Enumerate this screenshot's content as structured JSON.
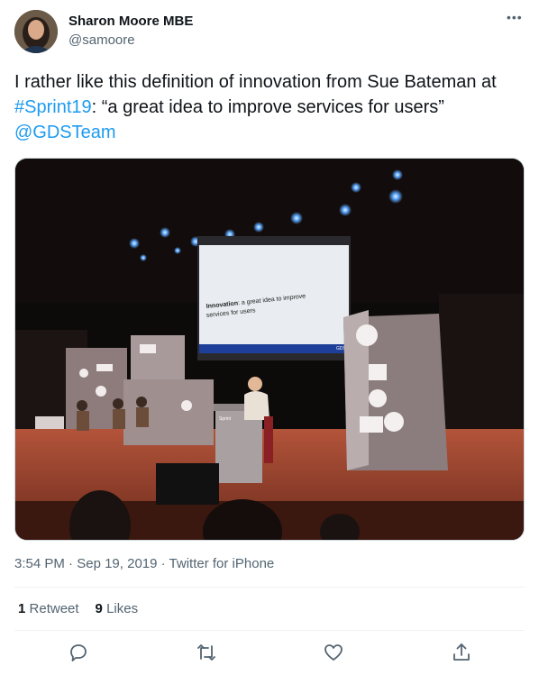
{
  "author": {
    "name": "Sharon Moore MBE",
    "handle": "@samoore"
  },
  "tweet": {
    "text_part1": "I rather like this definition of innovation from Sue Bateman at ",
    "hashtag": "#Sprint19",
    "text_part2": ": “a great idea to improve services for users” ",
    "mention": "@GDSTeam"
  },
  "media": {
    "slide_bold": "Innovation",
    "slide_line1_rest": ": a great idea to improve",
    "slide_line2": "services for users",
    "slide_corner": "GDS",
    "lectern_label": "Sprint"
  },
  "meta": {
    "time": "3:54 PM",
    "dot1": " · ",
    "date": "Sep 19, 2019",
    "dot2": " · ",
    "source": "Twitter for iPhone"
  },
  "stats": {
    "retweets_count": "1",
    "retweets_label": "Retweet",
    "likes_count": "9",
    "likes_label": "Likes"
  },
  "icons": {
    "more": "more-icon",
    "reply": "reply-icon",
    "retweet": "retweet-icon",
    "like": "like-icon",
    "share": "share-icon"
  },
  "colors": {
    "link": "#1d9bf0",
    "secondary_text": "#536471",
    "primary_text": "#0f1419"
  }
}
